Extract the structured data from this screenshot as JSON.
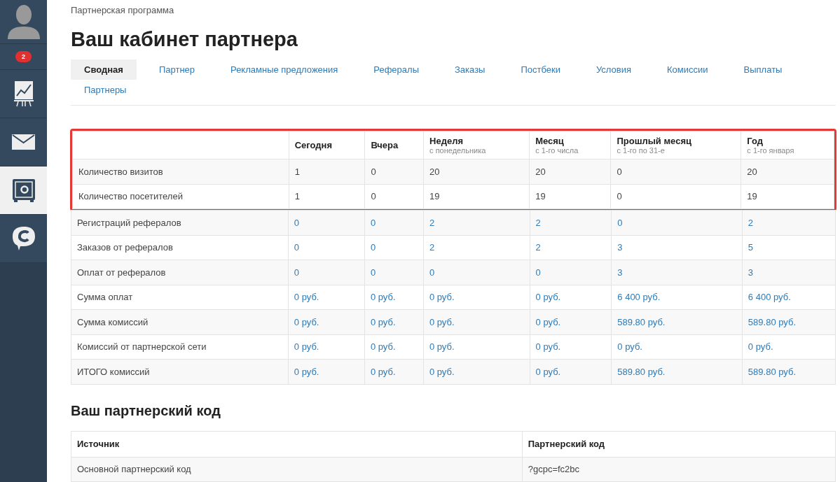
{
  "sidebar": {
    "badge": "2",
    "items": [
      {
        "kind": "chart",
        "selected": false
      },
      {
        "kind": "mail",
        "selected": false
      },
      {
        "kind": "safe",
        "selected": true
      },
      {
        "kind": "chat",
        "selected": false
      }
    ]
  },
  "breadcrumb": "Партнерская программа",
  "title": "Ваш кабинет партнера",
  "tabs": [
    {
      "label": "Сводная",
      "selected": true
    },
    {
      "label": "Партнер",
      "selected": false
    },
    {
      "label": "Рекламные предложения",
      "selected": false
    },
    {
      "label": "Рефералы",
      "selected": false
    },
    {
      "label": "Заказы",
      "selected": false
    },
    {
      "label": "Постбеки",
      "selected": false
    },
    {
      "label": "Условия",
      "selected": false
    },
    {
      "label": "Комиссии",
      "selected": false
    },
    {
      "label": "Выплаты",
      "selected": false
    },
    {
      "label": "Партнеры",
      "selected": false
    }
  ],
  "stats": {
    "highlighted": true,
    "columns": [
      {
        "title": "Сегодня"
      },
      {
        "title": "Вчера"
      },
      {
        "title": "Неделя",
        "subtitle": "с понедельника"
      },
      {
        "title": "Месяц",
        "subtitle": "с 1-го числа"
      },
      {
        "title": "Прошлый месяц",
        "subtitle": "с 1-го по 31-е"
      },
      {
        "title": "Год",
        "subtitle": "с 1-го января"
      }
    ],
    "rows": [
      {
        "label": "Количество визитов",
        "highlighted": true,
        "linked": false,
        "values": [
          "1",
          "0",
          "20",
          "20",
          "0",
          "20"
        ]
      },
      {
        "label": "Количество посетителей",
        "highlighted": true,
        "linked": false,
        "values": [
          "1",
          "0",
          "19",
          "19",
          "0",
          "19"
        ]
      },
      {
        "label": "Регистраций рефералов",
        "highlighted": false,
        "linked": true,
        "values": [
          "0",
          "0",
          "2",
          "2",
          "0",
          "2"
        ]
      },
      {
        "label": "Заказов от рефералов",
        "highlighted": false,
        "linked": true,
        "values": [
          "0",
          "0",
          "2",
          "2",
          "3",
          "5"
        ]
      },
      {
        "label": "Оплат от рефералов",
        "highlighted": false,
        "linked": true,
        "values": [
          "0",
          "0",
          "0",
          "0",
          "3",
          "3"
        ]
      },
      {
        "label": "Сумма оплат",
        "highlighted": false,
        "linked": true,
        "values": [
          "0 руб.",
          "0 руб.",
          "0 руб.",
          "0 руб.",
          "6 400 руб.",
          "6 400 руб."
        ]
      },
      {
        "label": "Сумма комиссий",
        "highlighted": false,
        "linked": true,
        "values": [
          "0 руб.",
          "0 руб.",
          "0 руб.",
          "0 руб.",
          "589.80 руб.",
          "589.80 руб."
        ]
      },
      {
        "label": "Комиссий от партнерской сети",
        "highlighted": false,
        "linked": true,
        "values": [
          "0 руб.",
          "0 руб.",
          "0 руб.",
          "0 руб.",
          "0 руб.",
          "0 руб."
        ]
      },
      {
        "label": "ИТОГО комиссий",
        "highlighted": false,
        "linked": true,
        "values": [
          "0 руб.",
          "0 руб.",
          "0 руб.",
          "0 руб.",
          "589.80 руб.",
          "589.80 руб."
        ]
      }
    ]
  },
  "code_section": {
    "title": "Ваш партнерский код",
    "columns": [
      "Источник",
      "Партнерский код"
    ],
    "rows": [
      [
        "Основной партнерский код",
        "?gcpc=fc2bc"
      ]
    ]
  }
}
